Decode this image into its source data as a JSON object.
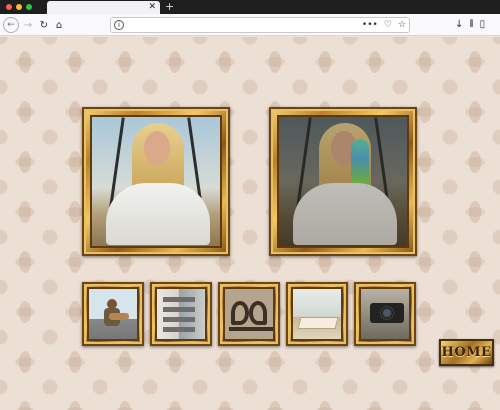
{
  "browser": {
    "tab_close_glyph": "✕",
    "new_tab_glyph": "+",
    "url": "",
    "icons": [
      "back-icon",
      "forward-icon",
      "reload-icon",
      "home-icon",
      "info-icon",
      "more-icon",
      "pocket-icon",
      "bookmark-star-icon",
      "download-icon",
      "library-icon",
      "sidebar-icon"
    ]
  },
  "gallery": {
    "featured": [
      {
        "name": "photo-original"
      },
      {
        "name": "photo-edited"
      }
    ],
    "thumbnails": [
      {
        "name": "thumb-guitarist"
      },
      {
        "name": "thumb-building"
      },
      {
        "name": "thumb-iron-scroll"
      },
      {
        "name": "thumb-open-book"
      },
      {
        "name": "thumb-camera"
      }
    ]
  },
  "home_button": {
    "label": "HOME"
  }
}
